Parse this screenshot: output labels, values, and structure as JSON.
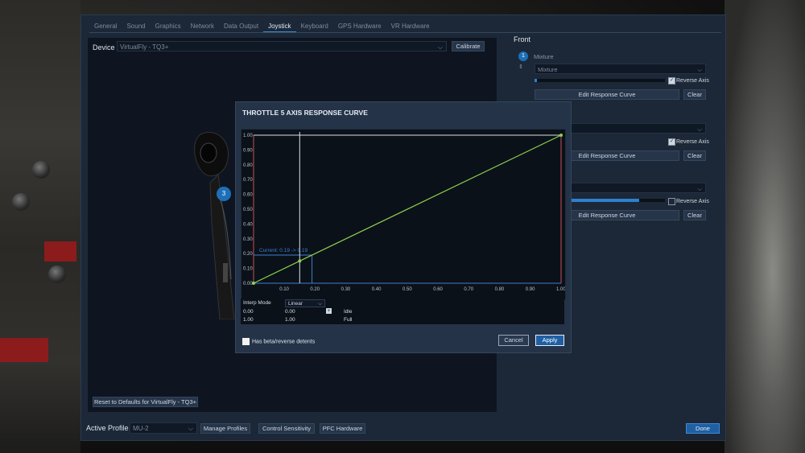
{
  "tabs": [
    "General",
    "Sound",
    "Graphics",
    "Network",
    "Data Output",
    "Joystick",
    "Keyboard",
    "GPS Hardware",
    "VR Hardware"
  ],
  "active_tab": "Joystick",
  "device": {
    "label": "Device",
    "value": "VirtualFly - TQ3+",
    "calibrate_label": "Calibrate"
  },
  "throttle_axis_badge": "3",
  "reset_label": "Reset to Defaults for VirtualFly - TQ3+",
  "bottom": {
    "active_profile_label": "Active Profile",
    "profile_value": "MU-2",
    "manage_profiles": "Manage Profiles",
    "control_sensitivity": "Control Sensitivity",
    "pfc_hardware": "PFC Hardware",
    "done": "Done"
  },
  "right": {
    "title": "Front",
    "axis_number": "1",
    "axis_name": "Mixture",
    "axis_select": "Mixture",
    "reverse_axis": "Reverse Axis",
    "edit_response_curve": "Edit Response Curve",
    "clear": "Clear",
    "axis1_fill": 0.02,
    "axis3_fill": 0.8
  },
  "dialog": {
    "title": "THROTTLE 5 AXIS RESPONSE CURVE",
    "interp_mode_label": "Interp Mode",
    "interp_mode_value": "Linear",
    "rows": [
      {
        "a": "0.00",
        "b": "0.00",
        "name": "Idle"
      },
      {
        "a": "1.00",
        "b": "1.00",
        "name": "Full"
      }
    ],
    "add_icon": "+",
    "beta_label": "Has beta/reverse detents",
    "cancel": "Cancel",
    "apply": "Apply"
  },
  "chart_data": {
    "type": "line",
    "x_ticks": [
      "0.10",
      "0.20",
      "0.30",
      "0.40",
      "0.50",
      "0.60",
      "0.70",
      "0.80",
      "0.90",
      "1.00"
    ],
    "y_ticks": [
      "1.00",
      "0.90",
      "0.80",
      "0.70",
      "0.60",
      "0.50",
      "0.40",
      "0.30",
      "0.20",
      "0.10",
      "0.00"
    ],
    "xlim": [
      0,
      1
    ],
    "ylim": [
      0,
      1
    ],
    "series": [
      {
        "x": [
          0,
          1
        ],
        "y": [
          0,
          1
        ]
      }
    ],
    "current_label": "Current: 0.19 -> 0.19",
    "current_x": 0.19,
    "marker_x": 0.15,
    "colors": {
      "curve": "#8fd14f",
      "marker": "#d8e0e8",
      "current": "#3d7fd0",
      "bound": "#c9505a"
    }
  }
}
